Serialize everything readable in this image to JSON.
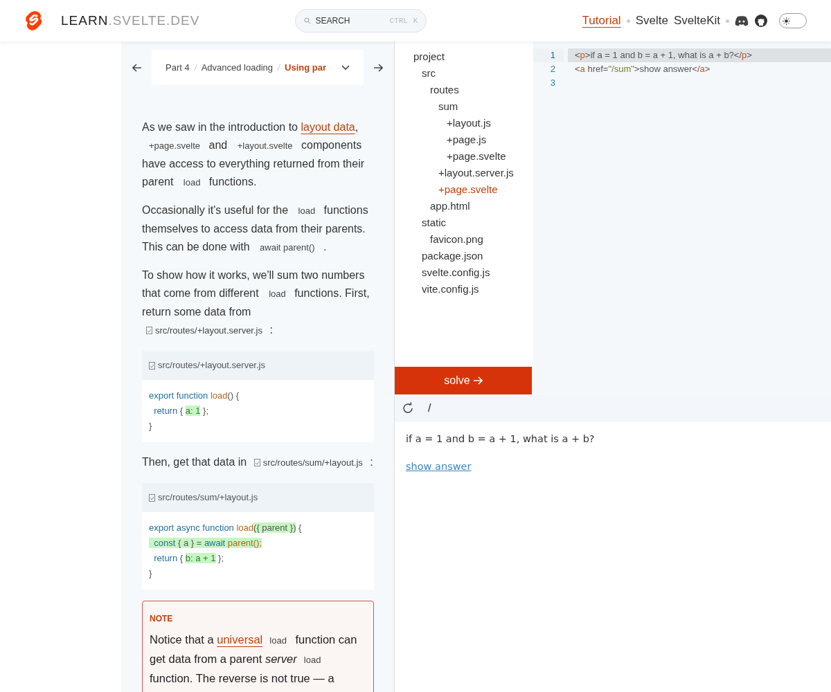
{
  "header": {
    "brand": "LEARN",
    "brand_domain": ".SVELTE.DEV",
    "search": {
      "placeholder": "SEARCH",
      "shortcut": [
        "CTRL",
        "K"
      ]
    },
    "nav": [
      {
        "label": "Tutorial",
        "selected": true
      },
      {
        "label": "Svelte",
        "selected": false
      },
      {
        "label": "SvelteKit",
        "selected": false
      }
    ],
    "theme_toggle": {
      "on": false
    }
  },
  "breadcrumb": [
    "Part 4",
    "Advanced loading",
    "Using par"
  ],
  "content": [
    {
      "kind": "paragraph",
      "segments": [
        {
          "kind": "text",
          "text": "As we saw in the introduction to "
        },
        {
          "kind": "link",
          "text": "layout data"
        },
        {
          "kind": "text",
          "text": ", "
        },
        {
          "kind": "code",
          "text": "+page.svelte"
        },
        {
          "kind": "text",
          "text": " and "
        },
        {
          "kind": "code",
          "text": "+layout.svelte"
        },
        {
          "kind": "text",
          "text": " components have access to everything returned from their parent "
        },
        {
          "kind": "code",
          "text": "load"
        },
        {
          "kind": "text",
          "text": " functions."
        }
      ]
    },
    {
      "kind": "paragraph",
      "segments": [
        {
          "kind": "text",
          "text": "Occasionally it's useful for the "
        },
        {
          "kind": "code",
          "text": "load"
        },
        {
          "kind": "text",
          "text": " functions themselves to access data from their parents. This can be done with "
        },
        {
          "kind": "code",
          "text": "await parent()"
        },
        {
          "kind": "text",
          "text": " ."
        }
      ]
    },
    {
      "kind": "paragraph",
      "segments": [
        {
          "kind": "text",
          "text": "To show how it works, we'll sum two numbers that come from different "
        },
        {
          "kind": "code",
          "text": "load"
        },
        {
          "kind": "text",
          "text": " functions. First, return some data from "
        },
        {
          "kind": "file",
          "text": "src/routes/+layout.server.js"
        },
        {
          "kind": "text",
          "text": " :"
        }
      ]
    },
    {
      "kind": "code",
      "file": "src/routes/+layout.server.js",
      "lines": [
        [
          {
            "kind": "keyword",
            "text": "export function ",
            "highlight": false
          },
          {
            "kind": "fn",
            "text": "load",
            "highlight": false
          },
          {
            "kind": "punct",
            "text": "() {",
            "highlight": false
          }
        ],
        [
          {
            "kind": "keyword",
            "text": "  return ",
            "highlight": false
          },
          {
            "kind": "punct",
            "text": "{ ",
            "highlight": false
          },
          {
            "kind": "plain",
            "text": "a: 1",
            "highlight": true
          },
          {
            "kind": "punct",
            "text": " };",
            "highlight": false
          }
        ],
        [
          {
            "kind": "punct",
            "text": "}",
            "highlight": false
          }
        ]
      ]
    },
    {
      "kind": "paragraph",
      "segments": [
        {
          "kind": "text",
          "text": "Then, get that data in "
        },
        {
          "kind": "file",
          "text": "src/routes/sum/+layout.js"
        },
        {
          "kind": "text",
          "text": " :"
        }
      ]
    },
    {
      "kind": "code",
      "file": "src/routes/sum/+layout.js",
      "lines": [
        [
          {
            "kind": "keyword",
            "text": "export async function ",
            "highlight": false
          },
          {
            "kind": "fn",
            "text": "load",
            "highlight": false
          },
          {
            "kind": "punct",
            "text": "({ parent })",
            "highlight": true
          },
          {
            "kind": "punct",
            "text": " {",
            "highlight": false
          }
        ],
        [
          {
            "kind": "keyword",
            "text": "  const ",
            "highlight": true
          },
          {
            "kind": "punct",
            "text": "{ a } = ",
            "highlight": true
          },
          {
            "kind": "keyword",
            "text": "await ",
            "highlight": true
          },
          {
            "kind": "fn",
            "text": "parent();",
            "highlight": true
          }
        ],
        [
          {
            "kind": "keyword",
            "text": "  return ",
            "highlight": false
          },
          {
            "kind": "punct",
            "text": "{ ",
            "highlight": false
          },
          {
            "kind": "plain",
            "text": "b: a + 1",
            "highlight": true
          },
          {
            "kind": "punct",
            "text": " };",
            "highlight": false
          }
        ],
        [
          {
            "kind": "punct",
            "text": "}",
            "highlight": false
          }
        ]
      ]
    },
    {
      "kind": "note",
      "title": "NOTE",
      "segments": [
        {
          "kind": "text",
          "text": "Notice that a "
        },
        {
          "kind": "link",
          "text": "universal"
        },
        {
          "kind": "code",
          "text": "load"
        },
        {
          "kind": "text",
          "text": " function can get data from a parent "
        },
        {
          "kind": "em",
          "text": "server"
        },
        {
          "kind": "code",
          "text": "load"
        },
        {
          "kind": "text",
          "text": " function. The reverse is not true — a"
        }
      ]
    }
  ],
  "file_tree": [
    {
      "name": "project",
      "selected": false,
      "children": [
        {
          "name": "src",
          "selected": false,
          "children": [
            {
              "name": "routes",
              "selected": false,
              "children": [
                {
                  "name": "sum",
                  "selected": false,
                  "children": [
                    {
                      "name": "+layout.js",
                      "selected": false
                    },
                    {
                      "name": "+page.js",
                      "selected": false
                    },
                    {
                      "name": "+page.svelte",
                      "selected": false
                    }
                  ]
                },
                {
                  "name": "+layout.server.js",
                  "selected": false
                },
                {
                  "name": "+page.svelte",
                  "selected": true
                }
              ]
            },
            {
              "name": "app.html",
              "selected": false
            }
          ]
        },
        {
          "name": "static",
          "selected": false,
          "children": [
            {
              "name": "favicon.png",
              "selected": false
            }
          ]
        },
        {
          "name": "package.json",
          "selected": false
        },
        {
          "name": "svelte.config.js",
          "selected": false
        },
        {
          "name": "vite.config.js",
          "selected": false
        }
      ]
    }
  ],
  "solve_button": "solve",
  "editor": {
    "lines": [
      {
        "number": "1",
        "active": true,
        "tokens": [
          {
            "kind": "punct",
            "text": "<"
          },
          {
            "kind": "tag",
            "text": "p"
          },
          {
            "kind": "punct",
            "text": ">if a = 1 and b = a + 1, what is a + b?</"
          },
          {
            "kind": "tag",
            "text": "p"
          },
          {
            "kind": "punct",
            "text": ">"
          }
        ]
      },
      {
        "number": "2",
        "active": false,
        "tokens": [
          {
            "kind": "punct",
            "text": "<"
          },
          {
            "kind": "tag",
            "text": "a"
          },
          {
            "kind": "punct",
            "text": " href="
          },
          {
            "kind": "string",
            "text": "\"/sum\""
          },
          {
            "kind": "punct",
            "text": ">show answer</"
          },
          {
            "kind": "tag",
            "text": "a"
          },
          {
            "kind": "punct",
            "text": ">"
          }
        ]
      },
      {
        "number": "3",
        "active": false
      }
    ]
  },
  "preview": {
    "path": "/",
    "text": "if a = 1 and b = a + 1, what is a + b?",
    "link": "show answer"
  }
}
